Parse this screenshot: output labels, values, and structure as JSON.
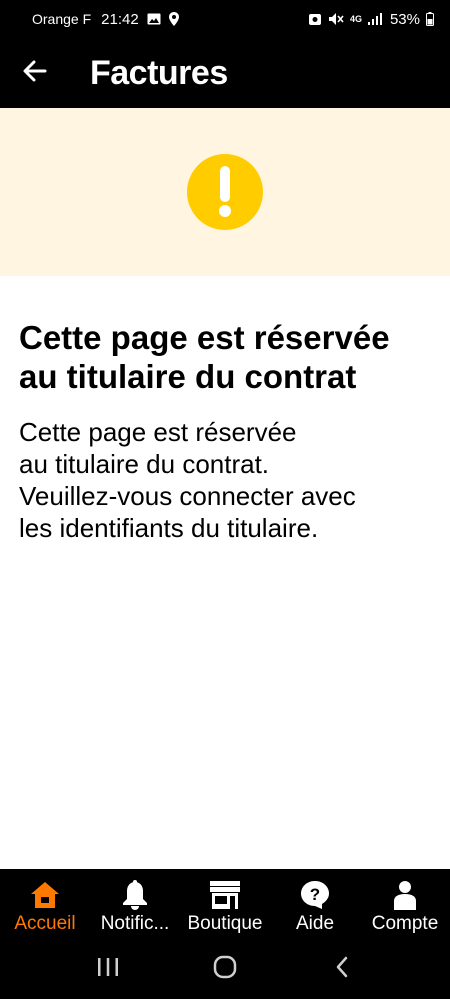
{
  "status_bar": {
    "carrier": "Orange F",
    "time": "21:42",
    "network": "4G",
    "battery": "53%"
  },
  "app_bar": {
    "title": "Factures",
    "back_icon": "arrow-left-icon"
  },
  "banner": {
    "icon": "warning-icon",
    "icon_color": "#ffcc00",
    "background": "#fff5e0",
    "glyph": "!"
  },
  "content": {
    "title": "Cette page est réservée au titulaire du contrat",
    "body_lines": [
      "Cette page est réservée",
      "au titulaire du contrat.",
      "Veuillez-vous connecter avec",
      "les identifiants du titulaire."
    ]
  },
  "bottom_nav": {
    "accent_color": "#ff7900",
    "items": [
      {
        "label": "Accueil",
        "icon": "home-icon",
        "active": true
      },
      {
        "label": "Notific...",
        "icon": "bell-icon",
        "active": false
      },
      {
        "label": "Boutique",
        "icon": "shop-icon",
        "active": false
      },
      {
        "label": "Aide",
        "icon": "help-icon",
        "active": false
      },
      {
        "label": "Compte",
        "icon": "user-icon",
        "active": false
      }
    ]
  },
  "system_nav": {
    "recents": "recents-icon",
    "home": "home-circle-icon",
    "back": "back-chevron-icon"
  }
}
